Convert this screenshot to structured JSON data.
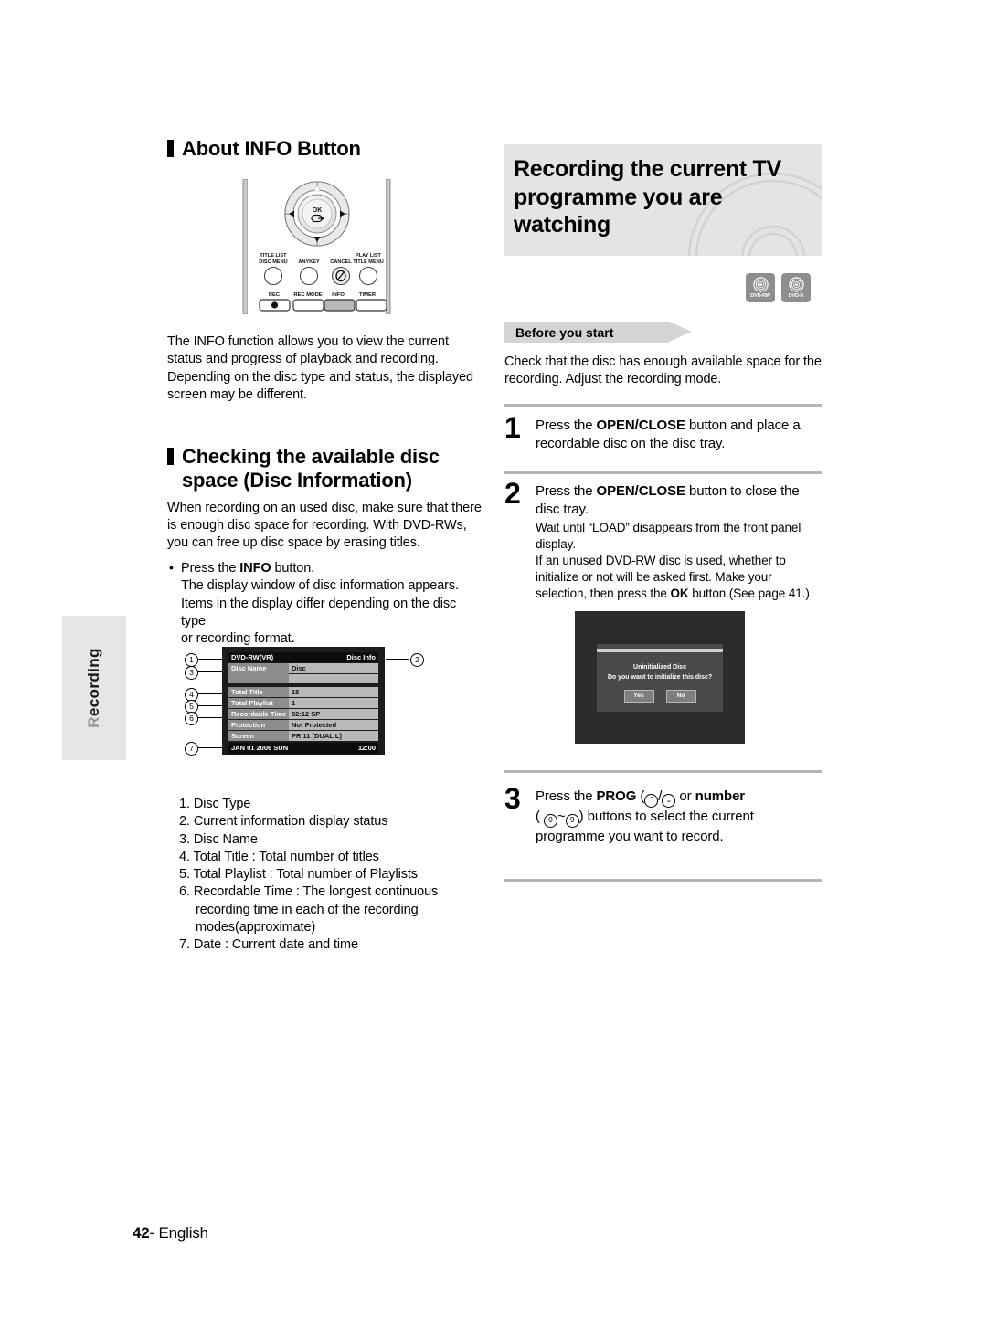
{
  "sidebar": {
    "tab_label": "Recording"
  },
  "left": {
    "section1": {
      "heading": "About INFO Button",
      "remote": {
        "ok_label": "OK",
        "row1": [
          {
            "l1": "TITLE LIST",
            "l2": "DISC MENU"
          },
          {
            "l1": "",
            "l2": "ANYKEY"
          },
          {
            "l1": "",
            "l2": "CANCEL"
          },
          {
            "l1": "PLAY LIST",
            "l2": "TITLE MENU"
          }
        ],
        "row2": [
          "REC",
          "REC MODE",
          "INFO",
          "TIMER"
        ]
      },
      "body": "The INFO function allows you to view the current status and progress of playback and recording. Depending on the disc type and status, the displayed screen may be different."
    },
    "section2": {
      "heading_line1": "Checking the available disc",
      "heading_line2": "space (Disc Information)",
      "body": "When recording on an used disc, make sure that there is enough disc space for recording. With DVD-RWs, you can free up disc space by erasing titles.",
      "bullet_lead": "Press the ",
      "bullet_bold": "INFO",
      "bullet_tail": " button.",
      "bullet_line2": "The display window of disc information appears.",
      "bullet_line3": "Items in the display differ depending on the disc type",
      "bullet_line4": "or recording format."
    },
    "disc_info_screen": {
      "header_left": "DVD-RW(VR)",
      "header_right": "Disc Info",
      "rows": [
        {
          "label": "Disc Name",
          "value": "Disc"
        },
        {
          "label": "Total Title",
          "value": "15"
        },
        {
          "label": "Total Playlist",
          "value": "1"
        },
        {
          "label": "Recordable Time",
          "value": "02:12 SP"
        },
        {
          "label": "Protection",
          "value": "Not Protected"
        },
        {
          "label": "Screen",
          "value": "PR 11 [DUAL L]"
        }
      ],
      "footer_left": "JAN  01 2006 SUN",
      "footer_right": "12:00",
      "callouts": [
        "1",
        "2",
        "3",
        "4",
        "5",
        "6",
        "7"
      ]
    },
    "legend": [
      "1. Disc Type",
      "2. Current information display status",
      "3. Disc Name",
      "4. Total Title : Total number of titles",
      "5. Total Playlist : Total number of Playlists",
      "6. Recordable Time : The longest continuous",
      "recording time in each of the recording",
      "modes(approximate)",
      "7. Date : Current date and time"
    ]
  },
  "right": {
    "title": "Recording the current TV programme you are watching",
    "badges": [
      {
        "label": "DVD-RW"
      },
      {
        "label": "DVD-R"
      }
    ],
    "before_you_start": {
      "tag": "Before you start",
      "body": "Check that the disc has enough available space for the recording. Adjust the recording mode."
    },
    "steps": [
      {
        "num": "1",
        "text_pre": "Press the ",
        "text_bold": "OPEN/CLOSE",
        "text_post": " button and place a recordable disc on the disc tray."
      },
      {
        "num": "2",
        "text_pre": "Press the ",
        "text_bold": "OPEN/CLOSE",
        "text_post": " button to close the disc tray.",
        "sub_line1": "Wait until “LOAD” disappears from the front panel display.",
        "sub_line2_pre": "If an unused DVD-RW disc is used, whether to initialize or not will be asked first. Make your selection, then press the ",
        "sub_line2_bold": "OK",
        "sub_line2_post": " button.(See page 41.)"
      },
      {
        "num": "3",
        "text_pre": "Press the ",
        "text_bold": "PROG",
        "text_mid": " (",
        "text_bold2": "number",
        "text_post": ") buttons to select the current programme you want to record.",
        "key_up": "⌃",
        "key_down": "⌄",
        "key_zero": "0",
        "key_nine": "9",
        "sep_slash": "/",
        "sep_tilde": "~",
        "or_text": " or "
      }
    ],
    "dialog": {
      "title": "Uninitialized Disc",
      "message": "Do you want to initialize this disc?",
      "yes": "Yes",
      "no": "No"
    }
  },
  "footer": {
    "page_number": "42",
    "dash": "- ",
    "language": "English"
  }
}
